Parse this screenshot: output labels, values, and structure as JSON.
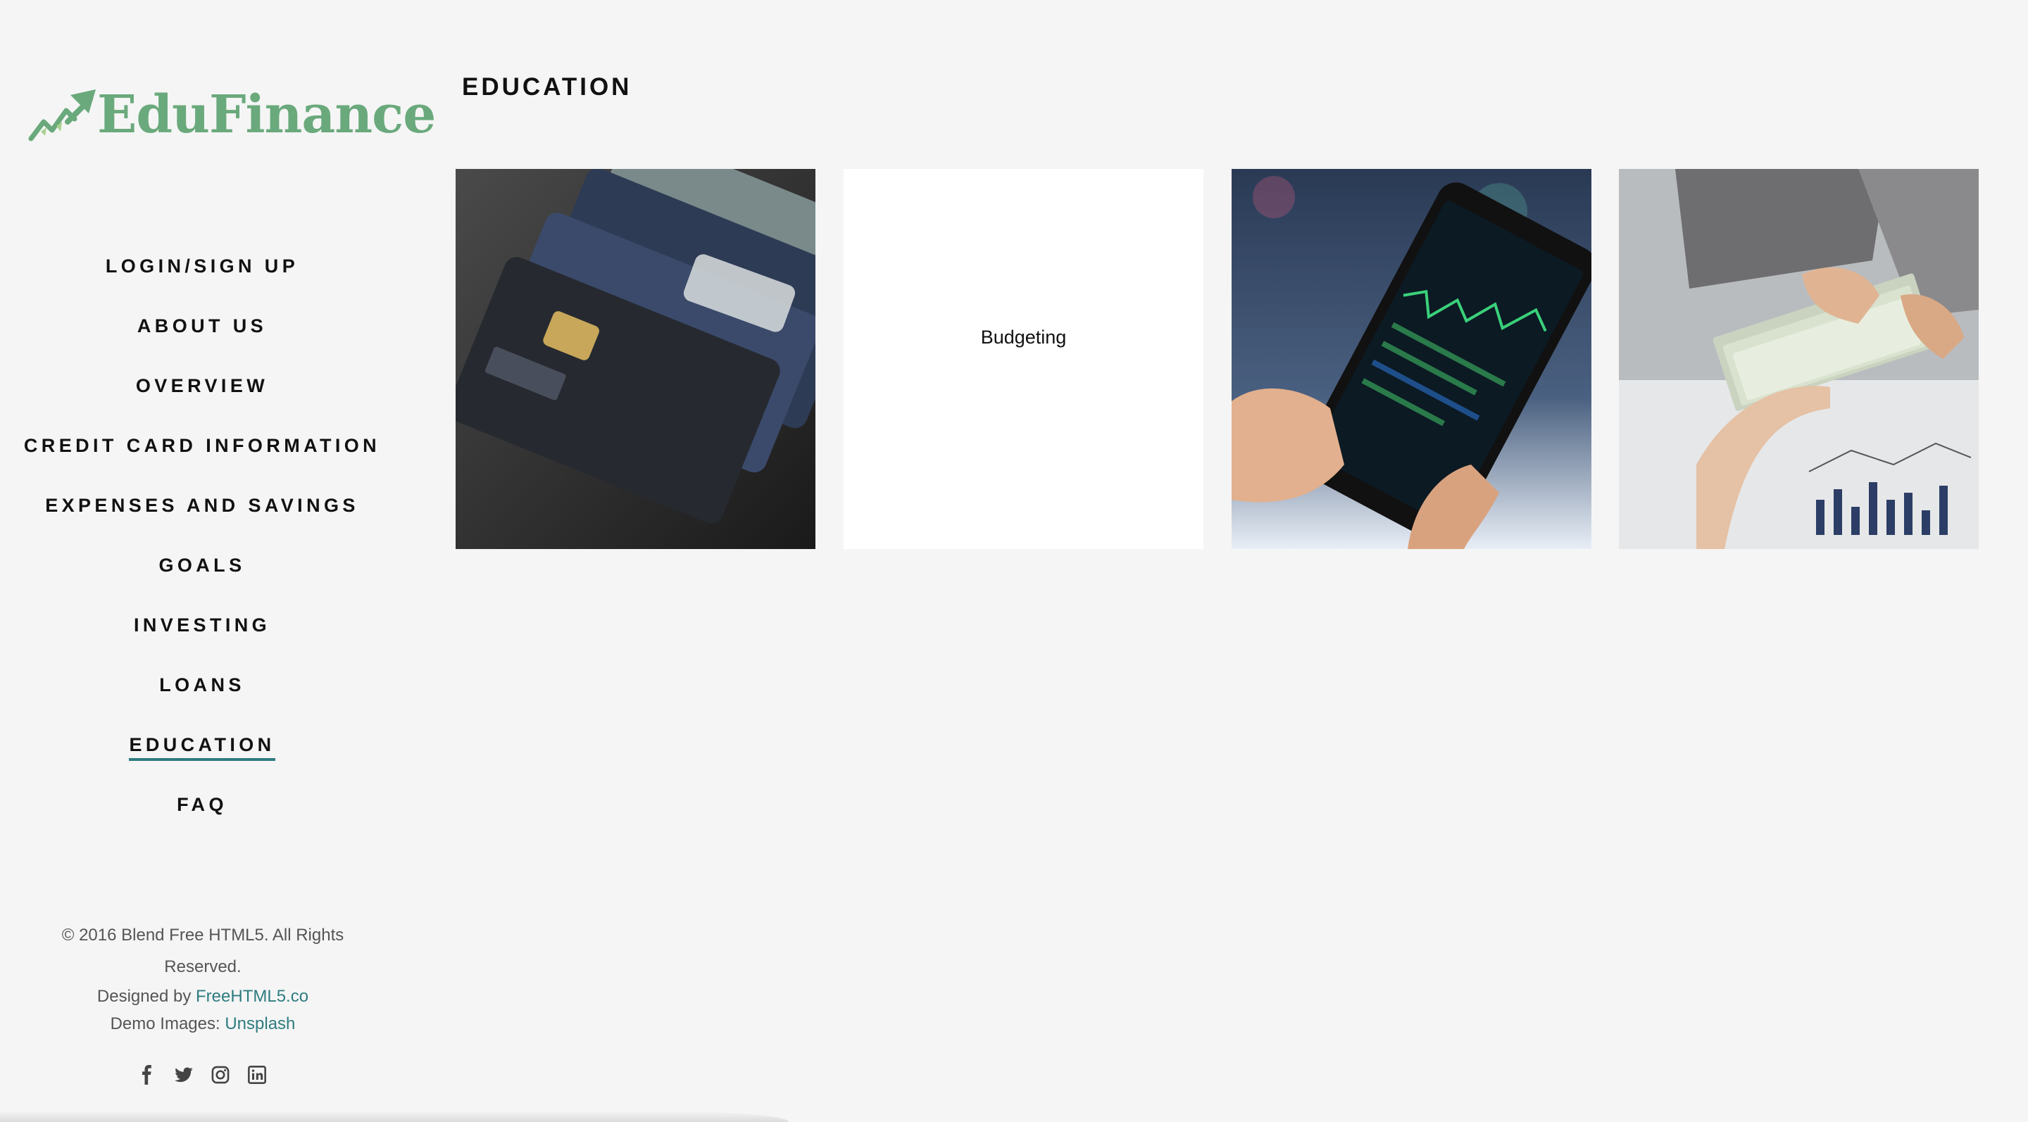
{
  "brand": {
    "name": "EduFinance",
    "color": "#6aa97c"
  },
  "nav": {
    "items": [
      {
        "label": "LOGIN/SIGN UP"
      },
      {
        "label": "ABOUT US"
      },
      {
        "label": "OVERVIEW"
      },
      {
        "label": "CREDIT CARD INFORMATION"
      },
      {
        "label": "EXPENSES AND SAVINGS"
      },
      {
        "label": "GOALS"
      },
      {
        "label": "INVESTING"
      },
      {
        "label": "LOANS"
      },
      {
        "label": "EDUCATION",
        "active": true
      },
      {
        "label": "FAQ"
      }
    ]
  },
  "footer": {
    "copyright": "© 2016 Blend Free HTML5. All Rights Reserved.",
    "designed_by_prefix": "Designed by",
    "designed_by_link": "FreeHTML5.co",
    "demo_images_prefix": "Demo Images:",
    "demo_images_link": "Unsplash",
    "link_color": "#2e7c80"
  },
  "social_icons": [
    "facebook-icon",
    "twitter-icon",
    "instagram-icon",
    "linkedin-icon"
  ],
  "main": {
    "title": "EDUCATION",
    "tiles": [
      {
        "type": "image",
        "depicts": "credit cards"
      },
      {
        "type": "text",
        "label": "Budgeting"
      },
      {
        "type": "image",
        "depicts": "smartphone with stock chart"
      },
      {
        "type": "image",
        "depicts": "hands exchanging dollar bills"
      }
    ]
  },
  "colors": {
    "background": "#f5f5f5",
    "accent": "#2e7c80"
  }
}
